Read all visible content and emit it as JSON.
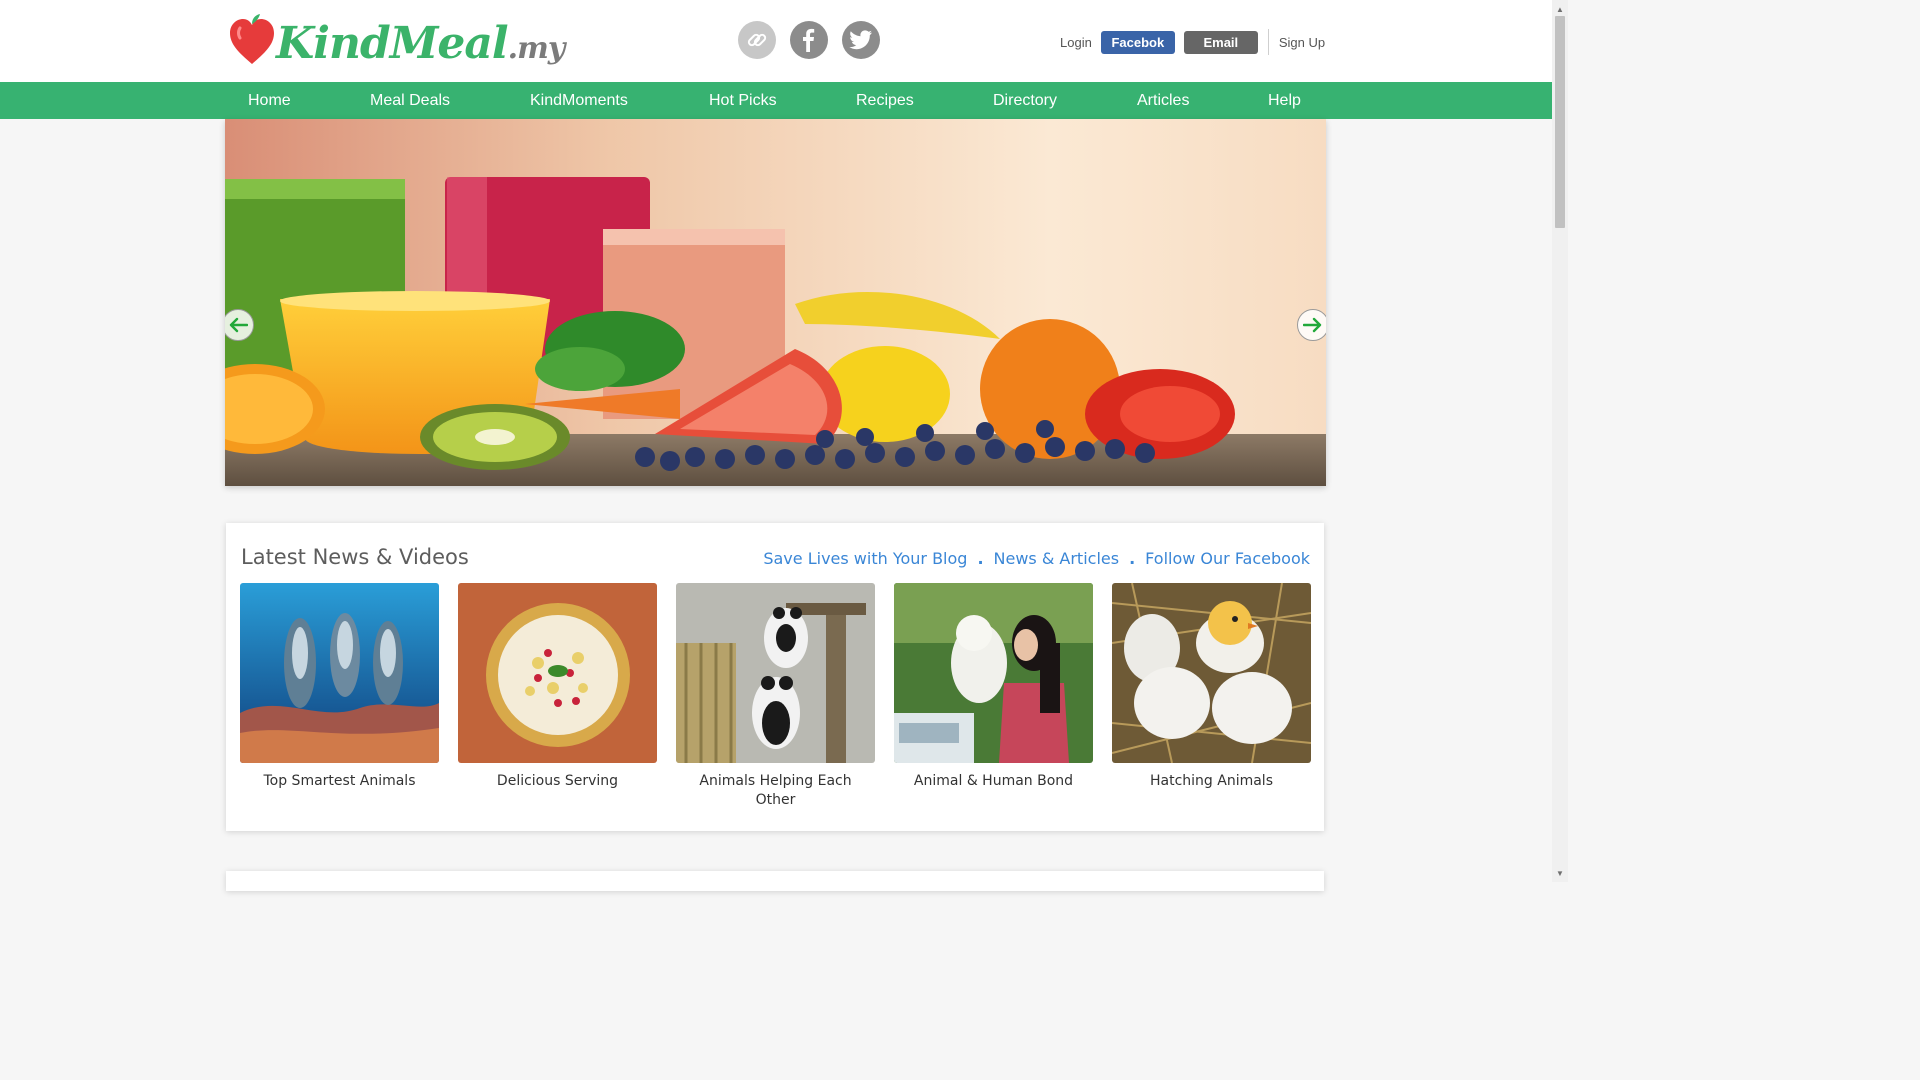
{
  "brand": {
    "name": "KindMeal",
    "suffix": ".my"
  },
  "social": {
    "link_icon": "link-icon",
    "facebook_icon": "facebook-icon",
    "twitter_icon": "twitter-icon"
  },
  "auth": {
    "login": "Login",
    "facebook": "Facebok",
    "email": "Email",
    "signup": "Sign Up"
  },
  "nav": {
    "items": [
      {
        "label": "Home"
      },
      {
        "label": "Meal Deals"
      },
      {
        "label": "KindMoments"
      },
      {
        "label": "Hot Picks"
      },
      {
        "label": "Recipes"
      },
      {
        "label": "Directory"
      },
      {
        "label": "Articles"
      },
      {
        "label": "Help"
      }
    ]
  },
  "hero": {
    "prev_icon": "arrow-left-icon",
    "next_icon": "arrow-right-icon"
  },
  "news": {
    "title": "Latest News & Videos",
    "links": [
      {
        "label": "Save Lives with Your Blog"
      },
      {
        "label": "News & Articles"
      },
      {
        "label": "Follow Our Facebook"
      }
    ],
    "separator": ".",
    "cards": [
      {
        "label": "Top Smartest Animals"
      },
      {
        "label": "Delicious Serving"
      },
      {
        "label": "Animals Helping Each Other"
      },
      {
        "label": "Animal & Human Bond"
      },
      {
        "label": "Hatching Animals"
      }
    ]
  },
  "colors": {
    "brand_green": "#37b271",
    "facebook_blue": "#3a64a8",
    "link_blue": "#3a86d6",
    "heart_red": "#e63b3b"
  }
}
